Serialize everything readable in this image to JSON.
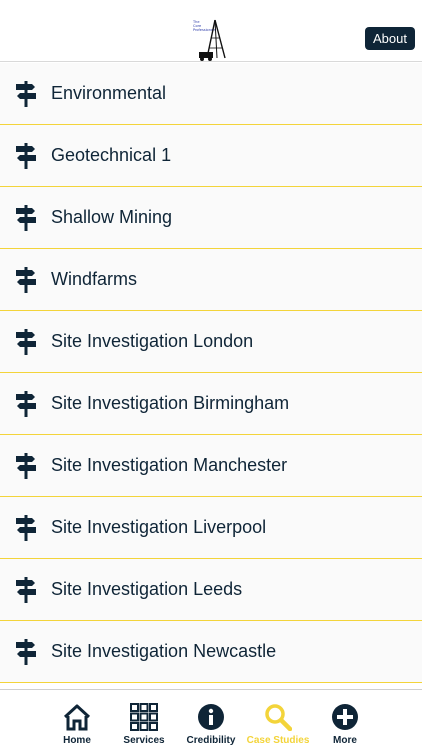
{
  "header": {
    "logo_lines": [
      "The",
      "Core",
      "Professionals"
    ],
    "about_label": "About"
  },
  "list": {
    "items": [
      {
        "label": "Environmental"
      },
      {
        "label": "Geotechnical 1"
      },
      {
        "label": "Shallow Mining"
      },
      {
        "label": "Windfarms"
      },
      {
        "label": "Site Investigation London"
      },
      {
        "label": "Site Investigation Birmingham"
      },
      {
        "label": "Site Investigation Manchester"
      },
      {
        "label": "Site Investigation Liverpool"
      },
      {
        "label": "Site Investigation Leeds"
      },
      {
        "label": "Site Investigation Newcastle"
      }
    ],
    "item_icon": "signpost-icon"
  },
  "tabbar": {
    "tabs": [
      {
        "label": "Home",
        "icon": "home-icon",
        "active": false
      },
      {
        "label": "Services",
        "icon": "grid-icon",
        "active": false
      },
      {
        "label": "Credibility",
        "icon": "info-icon",
        "active": false
      },
      {
        "label": "Case Studies",
        "icon": "search-icon",
        "active": true
      },
      {
        "label": "More",
        "icon": "plus-circle-icon",
        "active": false
      }
    ]
  },
  "colors": {
    "navy": "#0f2537",
    "accent_yellow": "#f3d43a",
    "row_background": "#fafafa"
  }
}
